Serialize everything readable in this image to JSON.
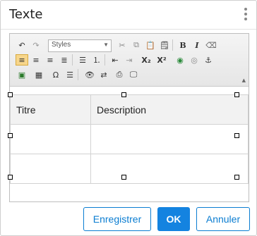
{
  "dialog": {
    "title": "Texte",
    "buttons": {
      "save": "Enregistrer",
      "ok": "OK",
      "cancel": "Annuler"
    }
  },
  "toolbar": {
    "styles_label": "Styles",
    "bold_label": "B",
    "italic_label": "I",
    "subscript_label": "X₂",
    "superscript_label": "X²",
    "omega_label": "Ω"
  },
  "table": {
    "headers": [
      "Titre",
      "Description"
    ],
    "rows": [
      [
        "",
        ""
      ],
      [
        "",
        ""
      ]
    ]
  }
}
